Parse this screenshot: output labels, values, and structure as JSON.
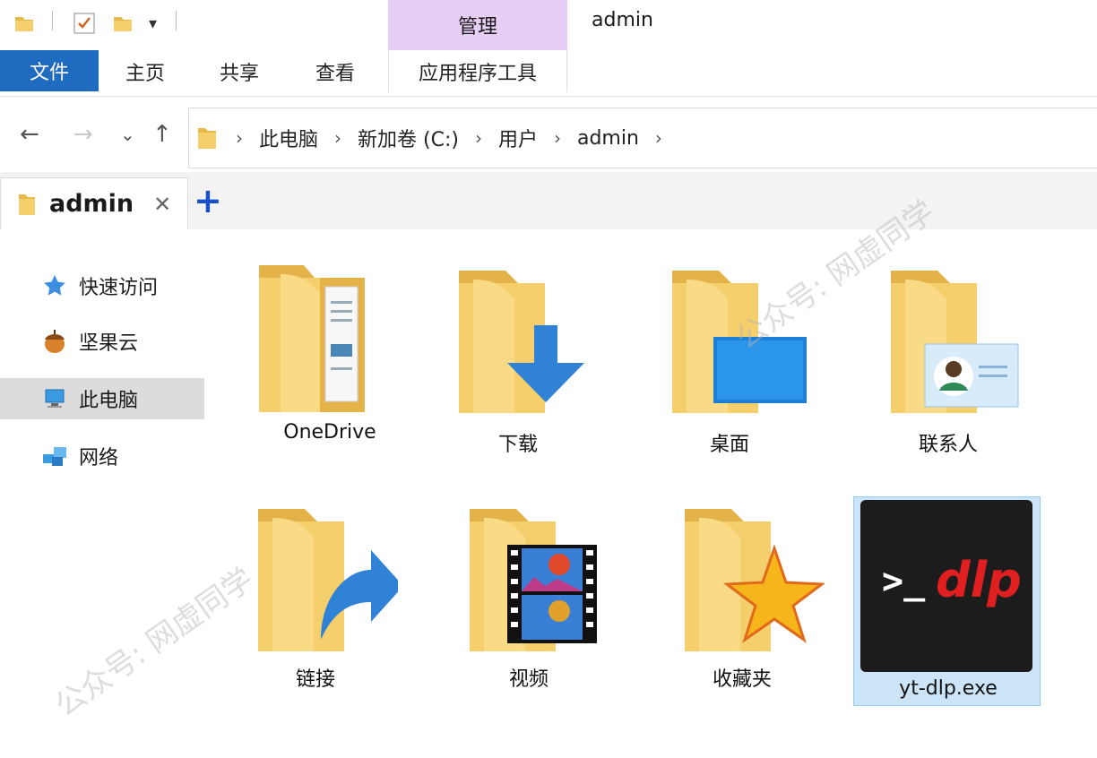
{
  "window": {
    "title": "admin",
    "contextual_tab_group": "管理"
  },
  "ribbon": {
    "tabs": [
      "文件",
      "主页",
      "共享",
      "查看",
      "应用程序工具"
    ]
  },
  "navigation": {
    "back": "←",
    "forward": "→",
    "recent": "⌄",
    "up": "↑",
    "breadcrumb": [
      "此电脑",
      "新加卷 (C:)",
      "用户",
      "admin"
    ],
    "separator": "›"
  },
  "tabs": {
    "active_label": "admin",
    "close": "✕",
    "add": "+"
  },
  "sidebar": {
    "items": [
      {
        "label": "快速访问",
        "icon": "star-icon"
      },
      {
        "label": "坚果云",
        "icon": "nut-icon"
      },
      {
        "label": "此电脑",
        "icon": "computer-icon",
        "selected": true
      },
      {
        "label": "网络",
        "icon": "network-icon"
      }
    ]
  },
  "files": [
    {
      "name": "OneDrive",
      "icon": "onedrive-folder-icon"
    },
    {
      "name": "下载",
      "icon": "downloads-folder-icon"
    },
    {
      "name": "桌面",
      "icon": "desktop-folder-icon"
    },
    {
      "name": "联系人",
      "icon": "contacts-folder-icon"
    },
    {
      "name": "链接",
      "icon": "links-folder-icon"
    },
    {
      "name": "视频",
      "icon": "videos-folder-icon"
    },
    {
      "name": "收藏夹",
      "icon": "favorites-folder-icon"
    },
    {
      "name": "yt-dlp.exe",
      "icon": "yt-dlp-exe-icon",
      "selected": true
    }
  ],
  "exe_icon_text": {
    "prompt": ">_",
    "brand": "dlp"
  },
  "watermarks": [
    "公众号: 网虚同学",
    "公众号: 网虚同学"
  ],
  "colors": {
    "file_tab": "#1f6bbf",
    "manage_tab": "#e6cef4",
    "folder": "#f5cf6b",
    "selection": "#cce4f7"
  }
}
